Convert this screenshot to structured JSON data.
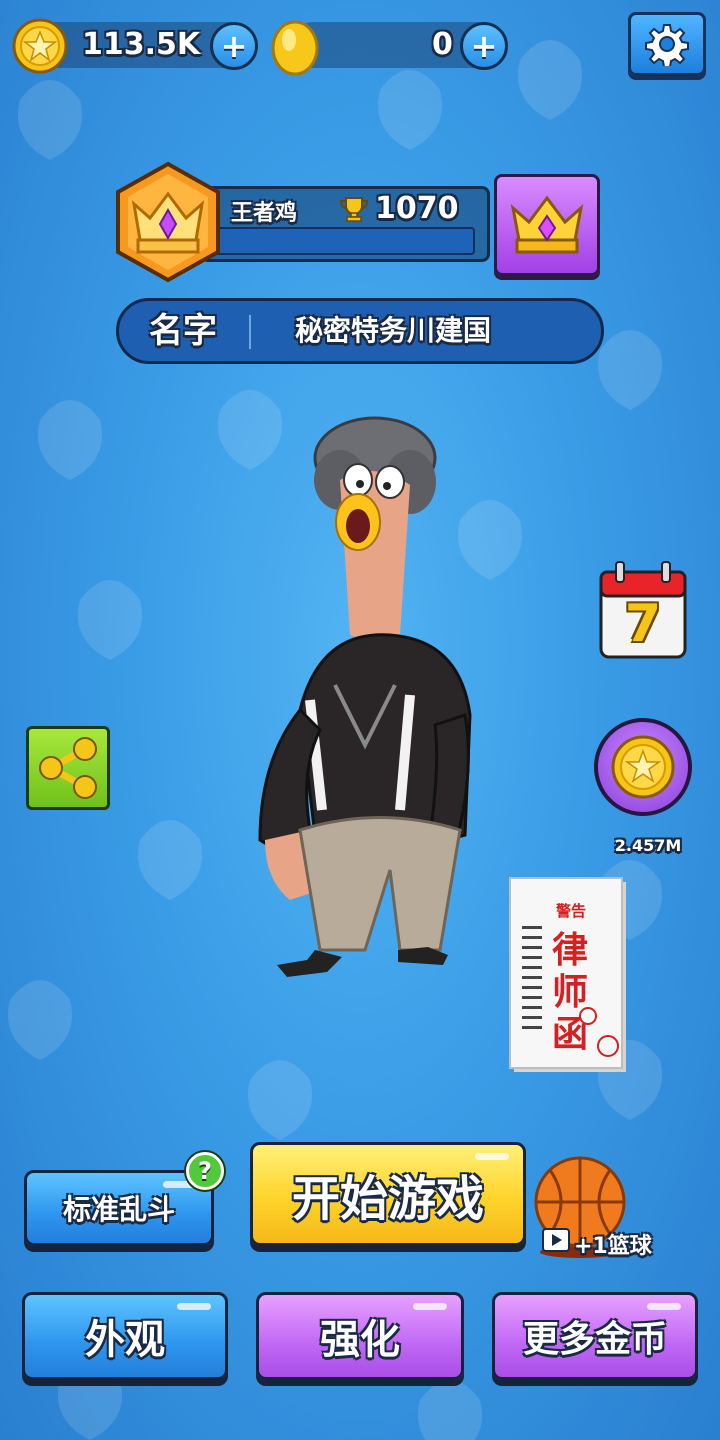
{
  "currency": {
    "coins": "113.5K",
    "gems": "0"
  },
  "profile": {
    "rank_name": "王者鸡",
    "trophies": "1070",
    "name_label": "名字",
    "name_value": "秘密特务川建国"
  },
  "side": {
    "calendar_day": "7",
    "coin_reward": "2.457M",
    "letter_title": "警告",
    "letter_body": "律师函"
  },
  "buttons": {
    "mode": "标准乱斗",
    "start": "开始游戏",
    "skin": "外观",
    "upgrade": "强化",
    "more_coins": "更多金币",
    "mode_help": "?",
    "ball_reward": "+1篮球"
  },
  "colors": {
    "background": "#3a9ce6",
    "blue_button": "#2e95ee",
    "purple_button": "#c068f5",
    "yellow_button": "#ffd42a",
    "coin_gold": "#f5c518"
  },
  "icons": [
    "star-coin-icon",
    "gem-icon",
    "plus-icon",
    "gear-icon",
    "rank-badge-icon",
    "trophy-icon",
    "crown-icon",
    "share-icon",
    "calendar-icon",
    "coin-icon",
    "letter-icon",
    "basketball-icon",
    "video-icon"
  ]
}
